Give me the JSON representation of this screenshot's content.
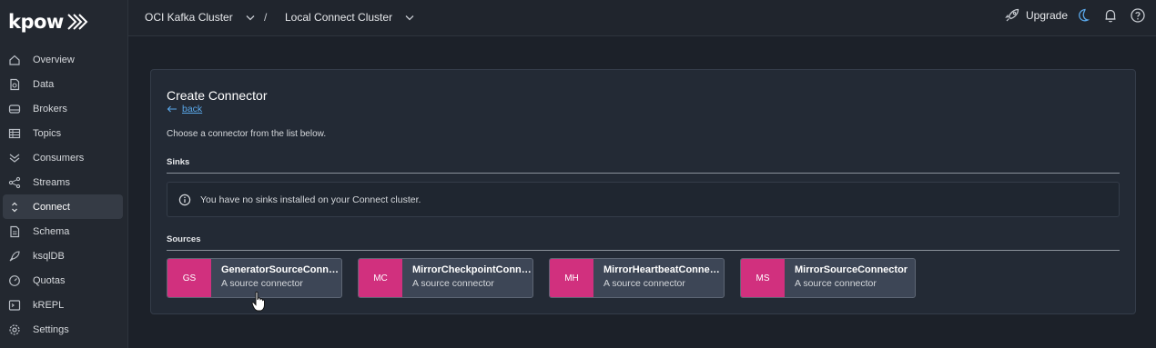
{
  "app": {
    "logo_text": "kpow"
  },
  "sidebar": {
    "items": [
      {
        "label": "Overview",
        "icon": "home-icon"
      },
      {
        "label": "Data",
        "icon": "file-search-icon"
      },
      {
        "label": "Brokers",
        "icon": "server-icon"
      },
      {
        "label": "Topics",
        "icon": "table-icon"
      },
      {
        "label": "Consumers",
        "icon": "double-chevron-down-icon"
      },
      {
        "label": "Streams",
        "icon": "share-icon"
      },
      {
        "label": "Connect",
        "icon": "chevron-up-down-icon",
        "active": true
      },
      {
        "label": "Schema",
        "icon": "document-icon"
      },
      {
        "label": "ksqlDB",
        "icon": "rocket-icon"
      },
      {
        "label": "Quotas",
        "icon": "gauge-icon"
      },
      {
        "label": "kREPL",
        "icon": "terminal-icon"
      },
      {
        "label": "Settings",
        "icon": "gear-icon"
      }
    ]
  },
  "header": {
    "breadcrumb": [
      "OCI Kafka Cluster",
      "Local Connect Cluster"
    ],
    "separator": "/",
    "upgrade_label": "Upgrade"
  },
  "main": {
    "title": "Create Connector",
    "back_label": "back",
    "intro": "Choose a connector from the list below.",
    "sinks": {
      "heading": "Sinks",
      "empty_message": "You have no sinks installed on your Connect cluster."
    },
    "sources": {
      "heading": "Sources",
      "connectors": [
        {
          "abbr": "GS",
          "name": "GeneratorSourceConnector",
          "description": "A source connector"
        },
        {
          "abbr": "MC",
          "name": "MirrorCheckpointConnector",
          "description": "A source connector"
        },
        {
          "abbr": "MH",
          "name": "MirrorHeartbeatConnector",
          "description": "A source connector"
        },
        {
          "abbr": "MS",
          "name": "MirrorSourceConnector",
          "description": "A source connector"
        }
      ]
    }
  },
  "colors": {
    "accent": "#d1307e",
    "link": "#5aa8ea",
    "background": "#1c2129",
    "panel": "#232a35"
  }
}
